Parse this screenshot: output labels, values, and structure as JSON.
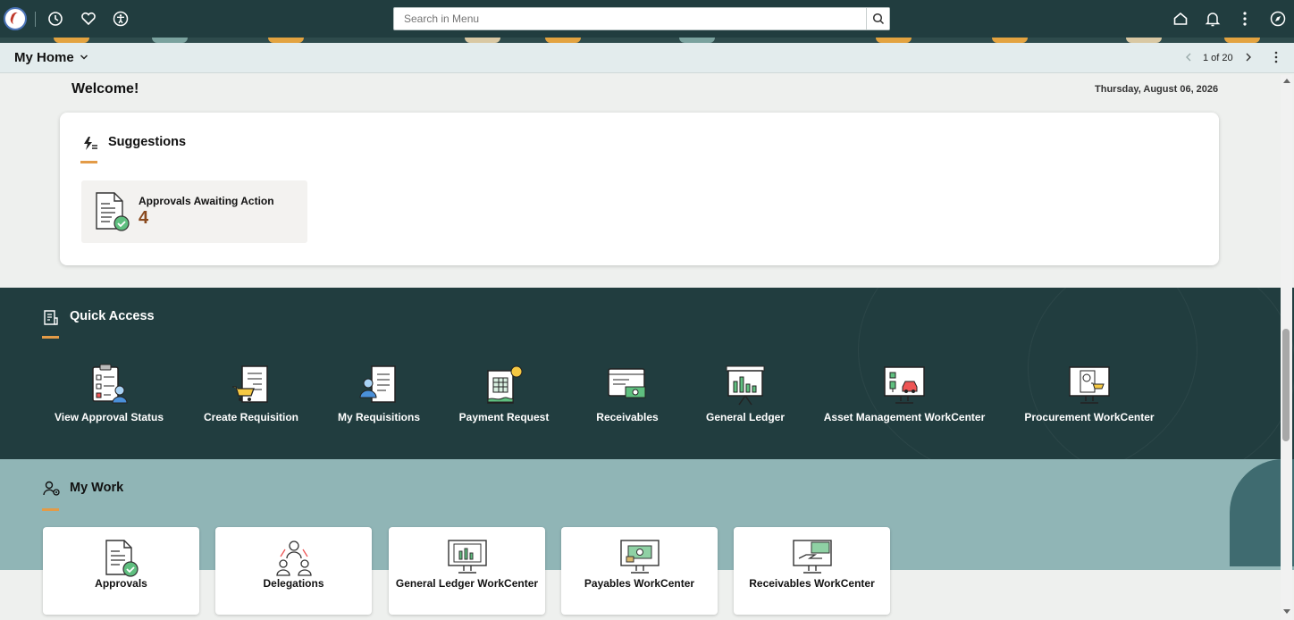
{
  "topbar": {
    "search": {
      "placeholder": "Search in Menu",
      "value": ""
    },
    "icons": [
      "logo-icon",
      "recent-icon",
      "favorites-icon",
      "accessibility-icon",
      "search-icon",
      "home-icon",
      "notifications-icon",
      "actions-menu-icon",
      "navigator-icon"
    ]
  },
  "titlebar": {
    "title": "My Home",
    "pager": "1 of 20"
  },
  "welcome": {
    "text": "Welcome!",
    "date": "Thursday, August 06, 2026"
  },
  "suggestions": {
    "title": "Suggestions",
    "tiles": [
      {
        "label": "Approvals Awaiting Action",
        "count": "4"
      }
    ]
  },
  "quick_access": {
    "title": "Quick Access",
    "items": [
      {
        "label": "View Approval Status",
        "icon": "approval-status-icon"
      },
      {
        "label": "Create Requisition",
        "icon": "requisition-cart-icon"
      },
      {
        "label": "My Requisitions",
        "icon": "my-requisitions-icon"
      },
      {
        "label": "Payment Request",
        "icon": "payment-request-icon"
      },
      {
        "label": "Receivables",
        "icon": "receivables-icon"
      },
      {
        "label": "General Ledger",
        "icon": "general-ledger-icon"
      },
      {
        "label": "Asset Management WorkCenter",
        "icon": "asset-management-icon"
      },
      {
        "label": "Procurement WorkCenter",
        "icon": "procurement-icon"
      }
    ]
  },
  "my_work": {
    "title": "My Work",
    "tiles": [
      {
        "label": "Approvals",
        "icon": "approvals-icon"
      },
      {
        "label": "Delegations",
        "icon": "delegations-icon"
      },
      {
        "label": "General Ledger WorkCenter",
        "icon": "gl-workcenter-icon"
      },
      {
        "label": "Payables WorkCenter",
        "icon": "payables-workcenter-icon"
      },
      {
        "label": "Receivables WorkCenter",
        "icon": "receivables-workcenter-icon"
      }
    ]
  },
  "colors": {
    "dark_teal": "#213d3f",
    "accent_orange": "#e39b47",
    "mywork_bg": "#90b5b6",
    "count_brown": "#8a4a1e"
  }
}
